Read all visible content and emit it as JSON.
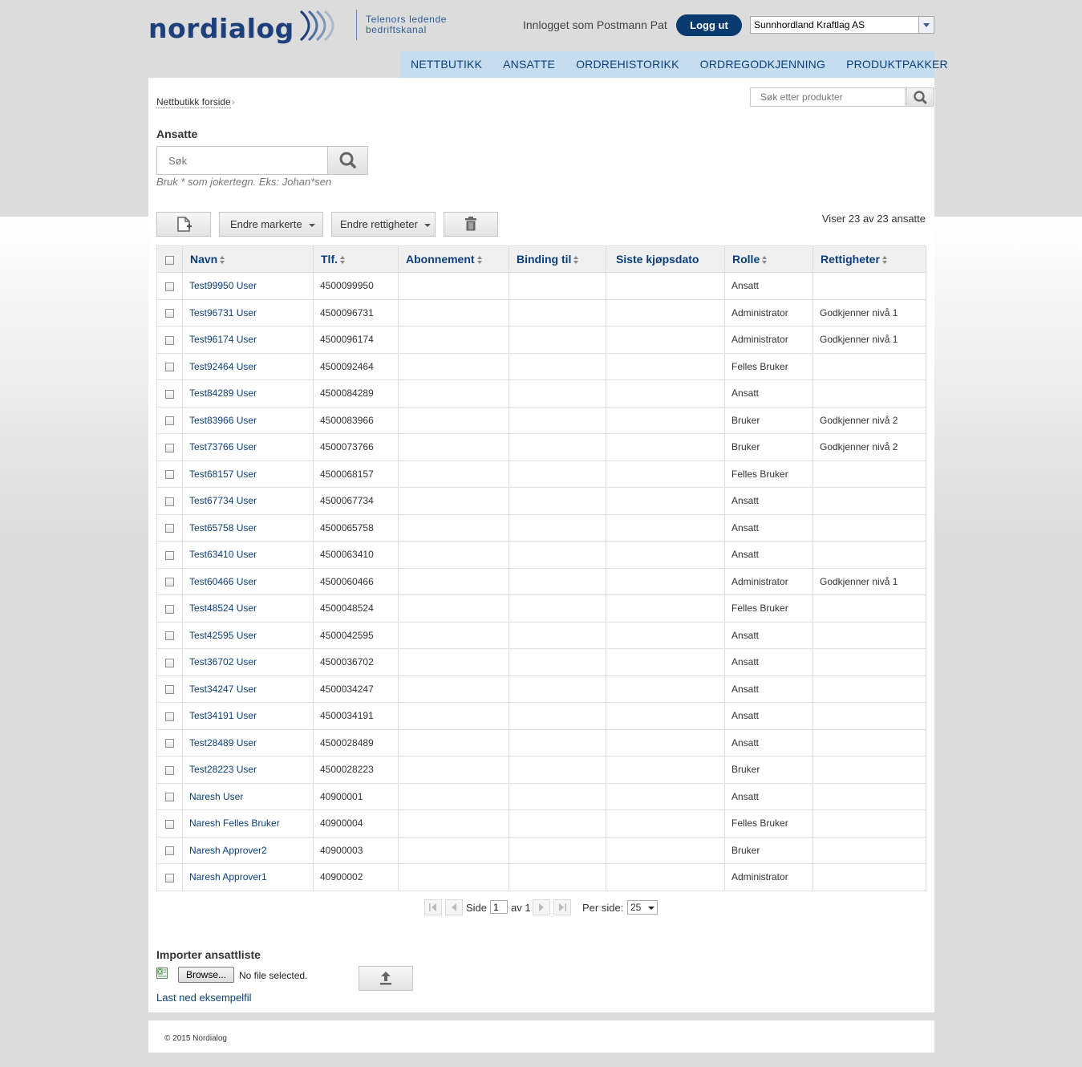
{
  "brand": {
    "logo_text": "nordialog",
    "tagline_line1": "Telenors ledende",
    "tagline_line2": "bedriftskanal",
    "brand_color": "#1d3f7a"
  },
  "header": {
    "logged_in_text": "Innlogget som Postmann Pat",
    "logout_label": "Logg ut",
    "company_selected": "Sunnhordland Kraftlag AS"
  },
  "nav": [
    {
      "label": "NETTBUTIKK"
    },
    {
      "label": "ANSATTE"
    },
    {
      "label": "ORDREHISTORIKK"
    },
    {
      "label": "ORDREGODKJENNING"
    },
    {
      "label": "PRODUKTPAKKER"
    }
  ],
  "breadcrumb": {
    "home": "Nettbutikk forside"
  },
  "product_search": {
    "placeholder": "Søk etter produkter",
    "icon": "search-icon"
  },
  "employees": {
    "title": "Ansatte",
    "search_placeholder": "Søk",
    "hint": "Bruk * som jokertegn. Eks: Johan*sen",
    "change_marked_label": "Endre markerte",
    "change_rights_label": "Endre rettigheter",
    "count_text": "Viser 23 av 23 ansatte"
  },
  "table": {
    "columns": {
      "name": "Navn",
      "phone": "Tlf.",
      "subscription": "Abonnement",
      "binding": "Binding til",
      "last_purchase": "Siste kjøpsdato",
      "role": "Rolle",
      "rights": "Rettigheter"
    },
    "rows": [
      {
        "name": "Test99950 User",
        "phone": "4500099950",
        "role": "Ansatt",
        "rights": ""
      },
      {
        "name": "Test96731 User",
        "phone": "4500096731",
        "role": "Administrator",
        "rights": "Godkjenner nivå 1"
      },
      {
        "name": "Test96174 User",
        "phone": "4500096174",
        "role": "Administrator",
        "rights": "Godkjenner nivå 1"
      },
      {
        "name": "Test92464 User",
        "phone": "4500092464",
        "role": "Felles Bruker",
        "rights": ""
      },
      {
        "name": "Test84289 User",
        "phone": "4500084289",
        "role": "Ansatt",
        "rights": ""
      },
      {
        "name": "Test83966 User",
        "phone": "4500083966",
        "role": "Bruker",
        "rights": "Godkjenner nivå 2"
      },
      {
        "name": "Test73766 User",
        "phone": "4500073766",
        "role": "Bruker",
        "rights": "Godkjenner nivå 2"
      },
      {
        "name": "Test68157 User",
        "phone": "4500068157",
        "role": "Felles Bruker",
        "rights": ""
      },
      {
        "name": "Test67734 User",
        "phone": "4500067734",
        "role": "Ansatt",
        "rights": ""
      },
      {
        "name": "Test65758 User",
        "phone": "4500065758",
        "role": "Ansatt",
        "rights": ""
      },
      {
        "name": "Test63410 User",
        "phone": "4500063410",
        "role": "Ansatt",
        "rights": ""
      },
      {
        "name": "Test60466 User",
        "phone": "4500060466",
        "role": "Administrator",
        "rights": "Godkjenner nivå 1"
      },
      {
        "name": "Test48524 User",
        "phone": "4500048524",
        "role": "Felles Bruker",
        "rights": ""
      },
      {
        "name": "Test42595 User",
        "phone": "4500042595",
        "role": "Ansatt",
        "rights": ""
      },
      {
        "name": "Test36702 User",
        "phone": "4500036702",
        "role": "Ansatt",
        "rights": ""
      },
      {
        "name": "Test34247 User",
        "phone": "4500034247",
        "role": "Ansatt",
        "rights": ""
      },
      {
        "name": "Test34191 User",
        "phone": "4500034191",
        "role": "Ansatt",
        "rights": ""
      },
      {
        "name": "Test28489 User",
        "phone": "4500028489",
        "role": "Ansatt",
        "rights": ""
      },
      {
        "name": "Test28223 User",
        "phone": "4500028223",
        "role": "Bruker",
        "rights": ""
      },
      {
        "name": "Naresh User",
        "phone": "40900001",
        "role": "Ansatt",
        "rights": ""
      },
      {
        "name": "Naresh Felles Bruker",
        "phone": "40900004",
        "role": "Felles Bruker",
        "rights": ""
      },
      {
        "name": "Naresh Approver2",
        "phone": "40900003",
        "role": "Bruker",
        "rights": ""
      },
      {
        "name": "Naresh Approver1",
        "phone": "40900002",
        "role": "Administrator",
        "rights": ""
      }
    ]
  },
  "pagination": {
    "page_label": "Side",
    "current_page": "1",
    "of_label": "av 1",
    "per_page_label": "Per side:",
    "per_page_value": "25"
  },
  "import": {
    "title": "Importer ansattliste",
    "browse_label": "Browse...",
    "file_status": "No file selected.",
    "sample_link": "Last ned eksempelfil"
  },
  "footer": {
    "copyright": "© 2015 Nordialog"
  }
}
